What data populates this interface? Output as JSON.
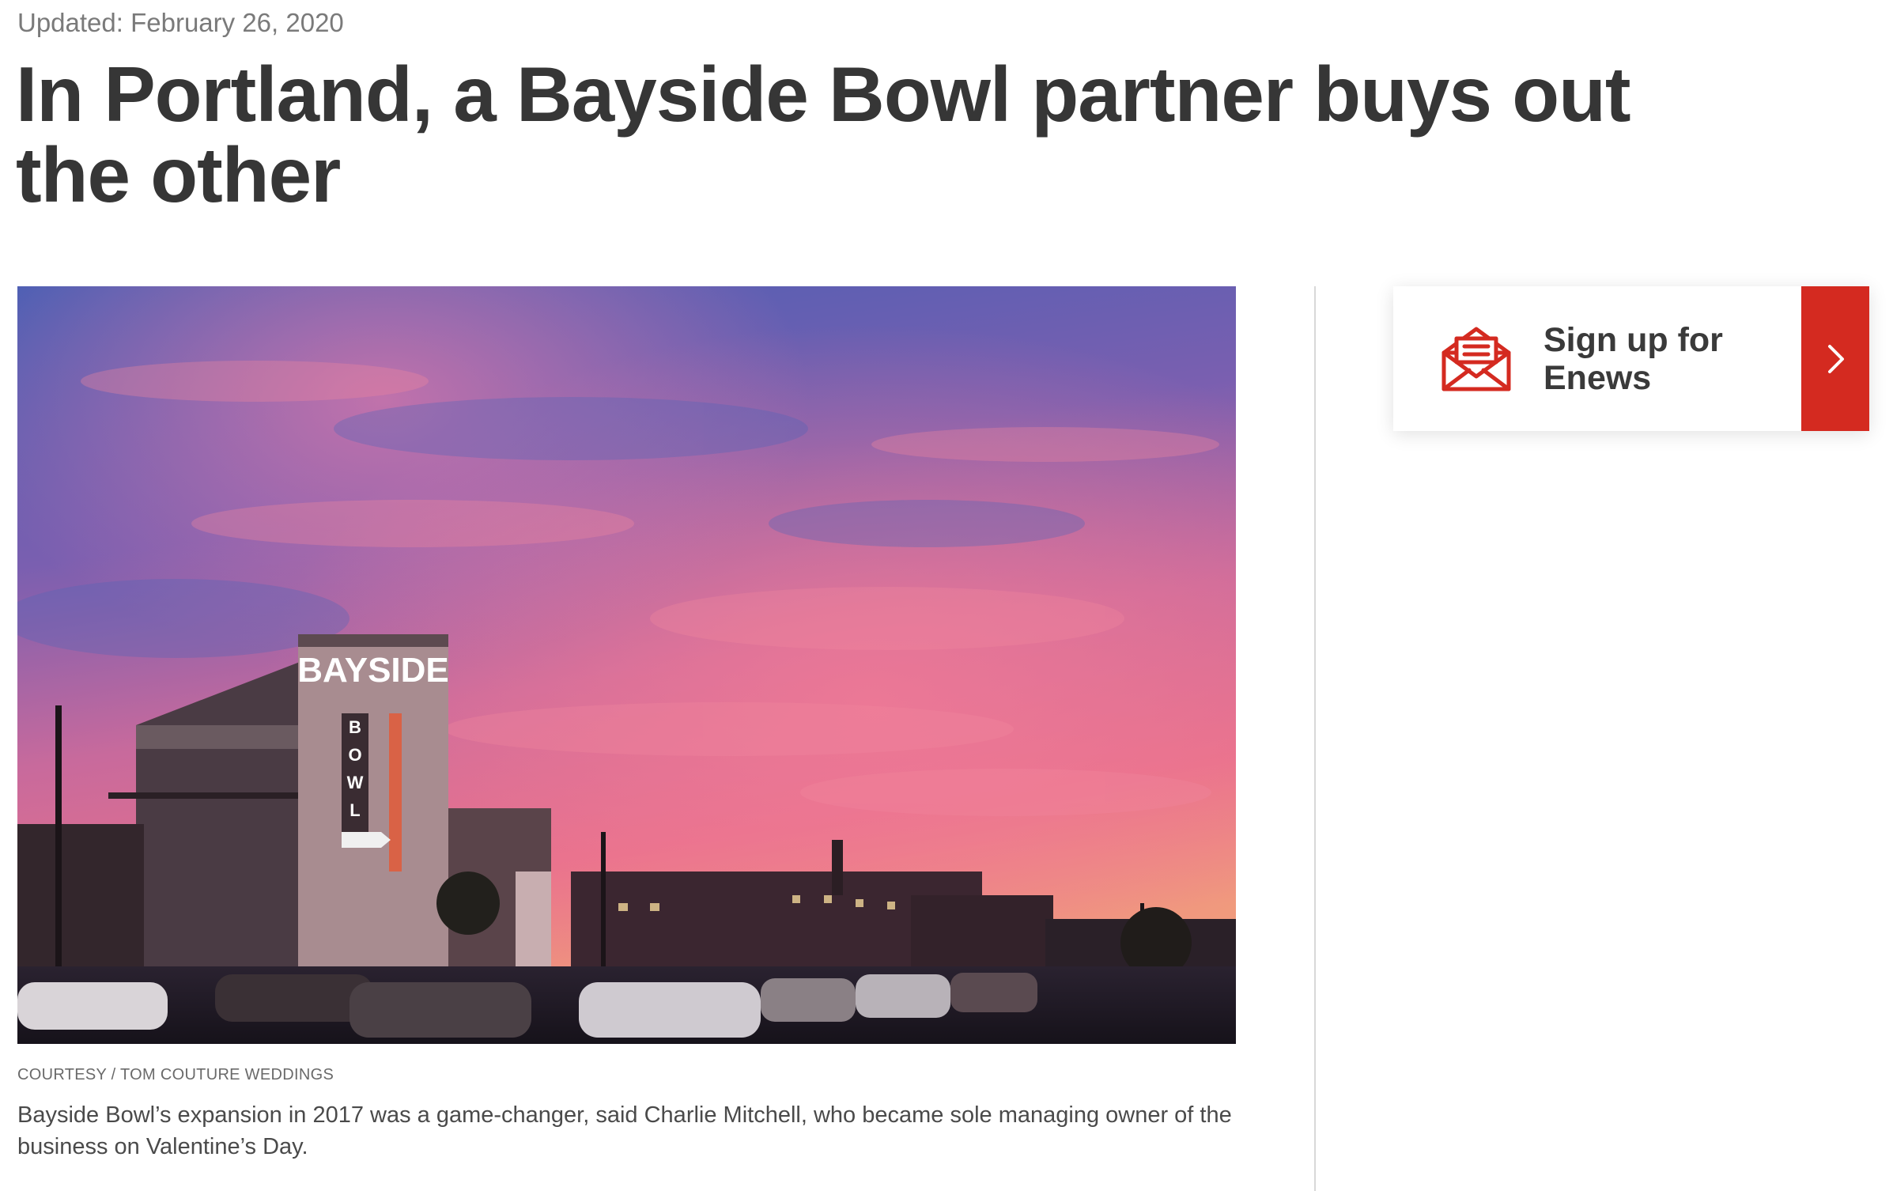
{
  "article": {
    "updated": "Updated: February 26, 2020",
    "headline": "In Portland, a Bayside Bowl partner buys out the other",
    "photo_credit": "COURTESY / TOM COUTURE WEDDINGS",
    "photo_caption": "Bayside Bowl’s expansion in 2017 was a game-changer, said Charlie Mitchell, who became sole managing owner of the business on Valentine’s Day.",
    "photo_sign_text": "BAYSIDE",
    "photo_sign_vertical": [
      "B",
      "O",
      "W",
      "L"
    ]
  },
  "sidebar": {
    "enews_label": "Sign up for Enews",
    "enews_icon": "envelope-newsletter-icon",
    "arrow_icon": "chevron-right-icon"
  },
  "colors": {
    "accent": "#d42a20",
    "headline": "#363636",
    "muted": "#7a7a7a"
  }
}
